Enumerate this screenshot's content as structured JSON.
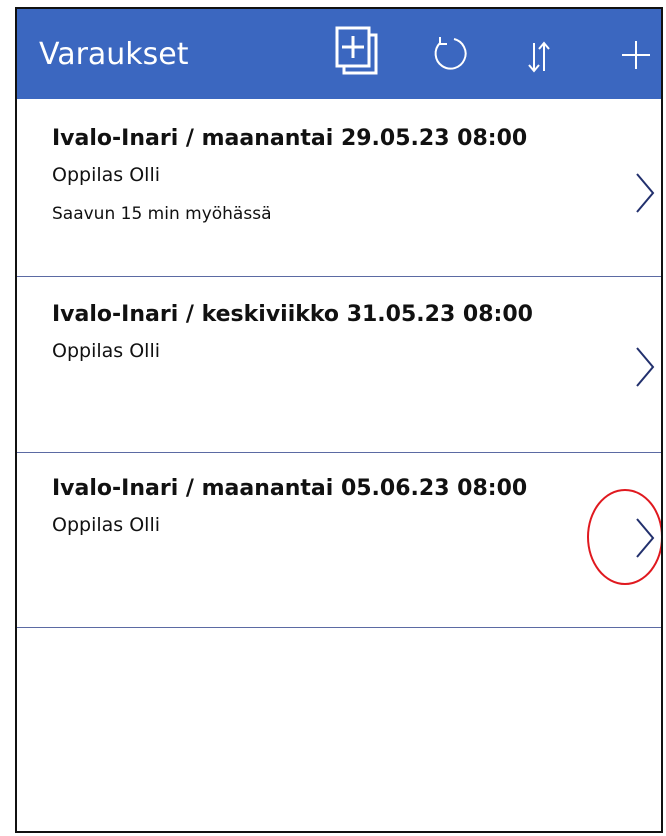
{
  "header": {
    "title": "Varaukset",
    "icons": [
      "add-item-icon",
      "refresh-icon",
      "sort-icon",
      "plus-icon"
    ],
    "background": "#3b67c0"
  },
  "bookings": [
    {
      "title": "Ivalo-Inari / maanantai 29.05.23 08:00",
      "student": "Oppilas Olli",
      "note": "Saavun 15 min myöhässä"
    },
    {
      "title": "Ivalo-Inari / keskiviikko 31.05.23 08:00",
      "student": "Oppilas Olli",
      "note": ""
    },
    {
      "title": "Ivalo-Inari / maanantai 05.06.23 08:00",
      "student": "Oppilas Olli",
      "note": ""
    }
  ],
  "colors": {
    "accent": "#3b67c0",
    "divider": "#5b6aa3",
    "chevron": "#22306d",
    "highlight": "#e0191f"
  }
}
